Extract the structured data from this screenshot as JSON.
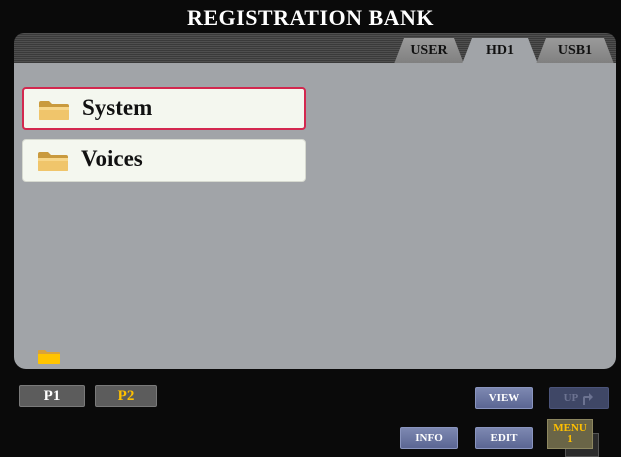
{
  "window": {
    "title": "REGISTRATION BANK"
  },
  "tabs": [
    {
      "label": "USER",
      "active": false
    },
    {
      "label": "HD1",
      "active": true
    },
    {
      "label": "USB1",
      "active": false
    }
  ],
  "files": [
    {
      "name": "System",
      "selected": true,
      "icon": "folder-icon"
    },
    {
      "name": "Voices",
      "selected": false,
      "icon": "folder-icon"
    }
  ],
  "pages": [
    {
      "label": "P1",
      "current": false
    },
    {
      "label": "P2",
      "current": true
    }
  ],
  "buttons": {
    "view": "VIEW",
    "up": "UP",
    "info": "INFO",
    "edit": "EDIT",
    "menu_line1": "MENU",
    "menu_line2": "1"
  },
  "colors": {
    "panel": "#a1a4a8",
    "selection_border": "#d3284f",
    "active_page_text": "#ffc000",
    "button_blue": "#6a75a1"
  }
}
